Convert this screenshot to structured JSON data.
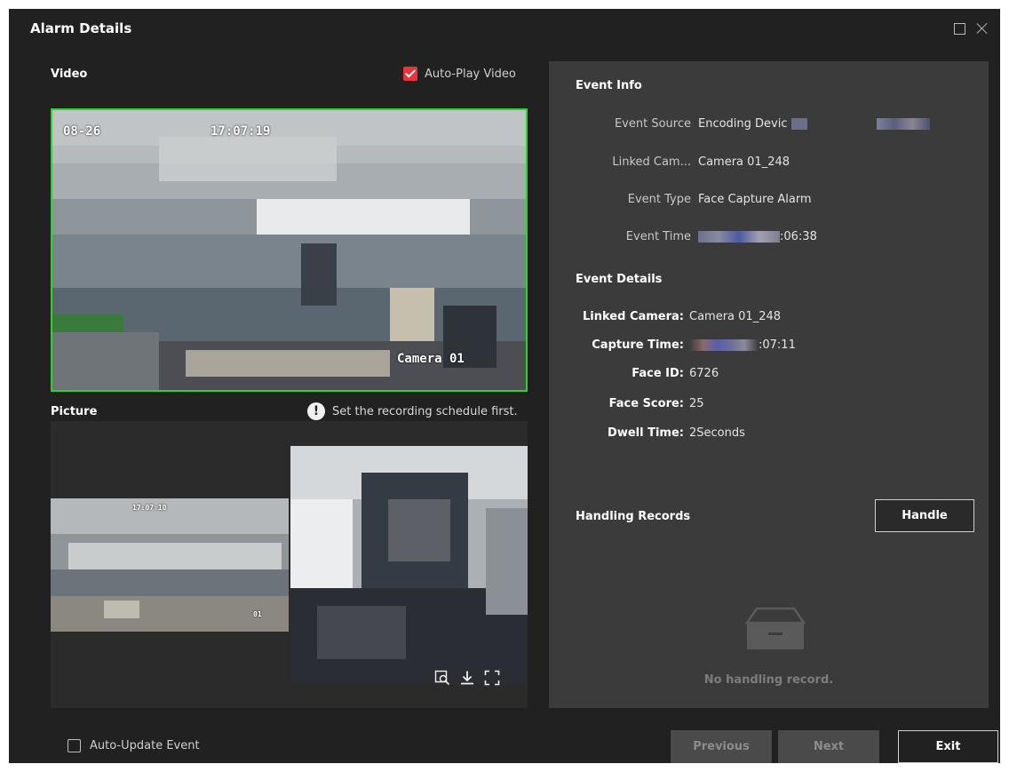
{
  "window": {
    "title": "Alarm Details"
  },
  "video": {
    "label": "Video",
    "autoplay_label": "Auto-Play Video",
    "autoplay_checked": true,
    "osd_date": "08-26",
    "osd_time": "17:07:19",
    "osd_camera": "Camera 01",
    "border_color": "#2bd62b"
  },
  "picture": {
    "label": "Picture",
    "warning": "Set the recording schedule first.",
    "scene_osd_time": "17:07:10",
    "scene_osd_cam": "01"
  },
  "event_info": {
    "heading": "Event Info",
    "rows": [
      {
        "label": "Event Source",
        "value": "Encoding Devic"
      },
      {
        "label": "Linked Cam...",
        "value": "Camera 01_248"
      },
      {
        "label": "Event Type",
        "value": "Face Capture Alarm"
      },
      {
        "label": "Event Time",
        "value": ":06:38"
      }
    ]
  },
  "event_details": {
    "heading": "Event Details",
    "rows": [
      {
        "label": "Linked Camera:",
        "value": "Camera 01_248"
      },
      {
        "label": "Capture Time:",
        "value": ":07:11"
      },
      {
        "label": "Face ID:",
        "value": "6726"
      },
      {
        "label": "Face Score:",
        "value": "25"
      },
      {
        "label": "Dwell Time:",
        "value": "2Seconds"
      }
    ]
  },
  "handling": {
    "heading": "Handling Records",
    "handle_label": "Handle",
    "empty_text": "No handling record."
  },
  "footer": {
    "autoupdate_label": "Auto-Update Event",
    "autoupdate_checked": false,
    "previous_label": "Previous",
    "next_label": "Next",
    "exit_label": "Exit"
  },
  "colors": {
    "accent_red": "#e8333d",
    "background": "#212121",
    "panel": "#3b3b3b"
  }
}
